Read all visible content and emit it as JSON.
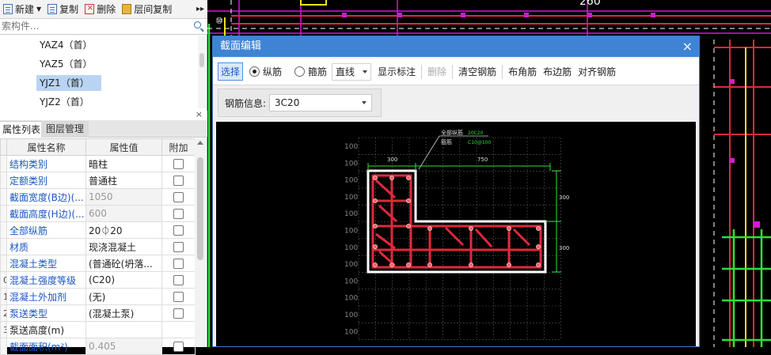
{
  "toolbar": {
    "new_label": "新建",
    "copy_label": "复制",
    "delete_label": "删除",
    "floor_copy_label": "层间复制",
    "more_label": "▸▸"
  },
  "search": {
    "placeholder": "索构件..."
  },
  "components": [
    "YAZ4（首）",
    "YAZ5（首）",
    "YJZ1（首）",
    "YJZ2（首）"
  ],
  "props_panel": {
    "close_label": "×",
    "tabs": [
      "属性列表",
      "图层管理"
    ],
    "columns": [
      "属性名称",
      "属性值",
      "附加"
    ],
    "rows": [
      {
        "num": "",
        "name": "结构类别",
        "value": "暗柱"
      },
      {
        "num": "",
        "name": "定额类别",
        "value": "普通柱"
      },
      {
        "num": "",
        "name": "截面宽度(B边)(...",
        "value": "1050"
      },
      {
        "num": "",
        "name": "截面高度(H边)(...",
        "value": "600"
      },
      {
        "num": "",
        "name": "全部纵筋",
        "value": "20⏀20"
      },
      {
        "num": "",
        "name": "材质",
        "value": "现浇混凝土"
      },
      {
        "num": "",
        "name": "混凝土类型",
        "value": "(普通砼(坍落..."
      },
      {
        "num": "0",
        "name": "混凝土强度等级",
        "value": "(C20)"
      },
      {
        "num": "1",
        "name": "混凝土外加剂",
        "value": "(无)"
      },
      {
        "num": "2",
        "name": "泵送类型",
        "value": "(混凝土泵)"
      },
      {
        "num": "3",
        "name": "泵送高度(m)",
        "value": ""
      },
      {
        "num": "",
        "name": "截面面积(m²)",
        "value": "0.405"
      }
    ]
  },
  "cad": {
    "top_label": "260"
  },
  "dialog": {
    "title": "截面编辑",
    "close_label": "×",
    "select_label": "选择",
    "long_bar_label": "纵筋",
    "stirrup_label": "箍筋",
    "line_mode": "直线",
    "show_dim_label": "显示标注",
    "delete_label": "删除",
    "clear_label": "清空钢筋",
    "corner_label": "布角筋",
    "edge_label": "布边筋",
    "align_label": "对齐钢筋",
    "steel_info_label": "钢筋信息:",
    "steel_info_value": "3C20"
  },
  "section": {
    "dim_top_left": "300",
    "dim_top_right": "750",
    "dim_right_top": "300",
    "dim_right_bottom": "300",
    "grid_label": "100",
    "annotation_1": "全部纵筋",
    "annotation_2": "箍筋",
    "annotation_1_value": "20C20",
    "annotation_2_value": "C10@100"
  },
  "colors": {
    "title_bar": "#3f84d4",
    "rebar_red": "#e0283c",
    "dim_green": "#2fe03a",
    "cad_magenta": "#d617d6",
    "cad_yellow": "#f0e21a"
  }
}
